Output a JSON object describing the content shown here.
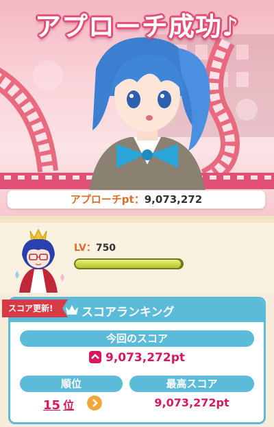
{
  "hero": {
    "title": "アプローチ成功♪",
    "points_label": "アプローチpt：",
    "points_value": "9,073,272"
  },
  "player": {
    "level_label": "LV：",
    "level_value": "750",
    "exp_fraction": 0.99
  },
  "ranking": {
    "new_score_badge": "スコア更新!",
    "title": "スコアランキング",
    "current_score_label": "今回のスコア",
    "current_score": "9,073,272pt",
    "rank_label": "順位",
    "rank_value": "15",
    "rank_unit": "位",
    "best_score_label": "最高スコア",
    "best_score": "9,073,272pt"
  },
  "colors": {
    "accent": "#5bbbd8",
    "score": "#d8175d",
    "label_orange": "#e06c2a",
    "title_pink": "#e24f77"
  },
  "icons": [
    "film-strip-icon",
    "crown-icon",
    "up-arrow-icon",
    "chevron-right-icon"
  ]
}
